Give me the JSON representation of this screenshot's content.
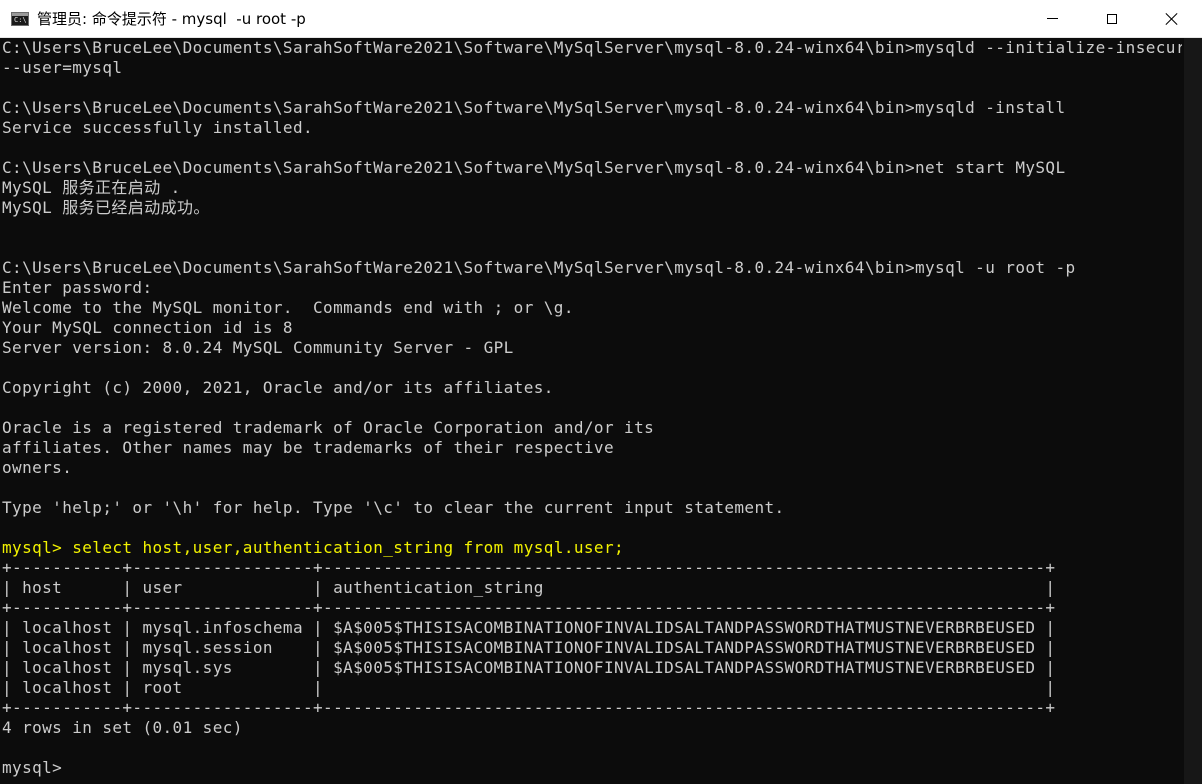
{
  "window": {
    "icon_label": "C:\\",
    "title": "管理员: 命令提示符 - mysql  -u root -p"
  },
  "console": {
    "lines": [
      {
        "text": "C:\\Users\\BruceLee\\Documents\\SarahSoftWare2021\\Software\\MySqlServer\\mysql-8.0.24-winx64\\bin>mysqld --initialize-insecure"
      },
      {
        "text": "--user=mysql"
      },
      {
        "text": ""
      },
      {
        "text": "C:\\Users\\BruceLee\\Documents\\SarahSoftWare2021\\Software\\MySqlServer\\mysql-8.0.24-winx64\\bin>mysqld -install"
      },
      {
        "text": "Service successfully installed."
      },
      {
        "text": ""
      },
      {
        "text": "C:\\Users\\BruceLee\\Documents\\SarahSoftWare2021\\Software\\MySqlServer\\mysql-8.0.24-winx64\\bin>net start MySQL"
      },
      {
        "text": "MySQL 服务正在启动 ."
      },
      {
        "text": "MySQL 服务已经启动成功。"
      },
      {
        "text": ""
      },
      {
        "text": ""
      },
      {
        "text": "C:\\Users\\BruceLee\\Documents\\SarahSoftWare2021\\Software\\MySqlServer\\mysql-8.0.24-winx64\\bin>mysql -u root -p"
      },
      {
        "text": "Enter password:"
      },
      {
        "text": "Welcome to the MySQL monitor.  Commands end with ; or \\g."
      },
      {
        "text": "Your MySQL connection id is 8"
      },
      {
        "text": "Server version: 8.0.24 MySQL Community Server - GPL"
      },
      {
        "text": ""
      },
      {
        "text": "Copyright (c) 2000, 2021, Oracle and/or its affiliates."
      },
      {
        "text": ""
      },
      {
        "text": "Oracle is a registered trademark of Oracle Corporation and/or its"
      },
      {
        "text": "affiliates. Other names may be trademarks of their respective"
      },
      {
        "text": "owners."
      },
      {
        "text": ""
      },
      {
        "text": "Type 'help;' or '\\h' for help. Type '\\c' to clear the current input statement."
      },
      {
        "text": ""
      },
      {
        "text": "mysql> select host,user,authentication_string from mysql.user;",
        "highlight": true
      },
      {
        "text": "+-----------+------------------+------------------------------------------------------------------------+"
      },
      {
        "text": "| host      | user             | authentication_string                                                  |"
      },
      {
        "text": "+-----------+------------------+------------------------------------------------------------------------+"
      },
      {
        "text": "| localhost | mysql.infoschema | $A$005$THISISACOMBINATIONOFINVALIDSALTANDPASSWORDTHATMUSTNEVERBRBEUSED |"
      },
      {
        "text": "| localhost | mysql.session    | $A$005$THISISACOMBINATIONOFINVALIDSALTANDPASSWORDTHATMUSTNEVERBRBEUSED |"
      },
      {
        "text": "| localhost | mysql.sys        | $A$005$THISISACOMBINATIONOFINVALIDSALTANDPASSWORDTHATMUSTNEVERBRBEUSED |"
      },
      {
        "text": "| localhost | root             |                                                                        |"
      },
      {
        "text": "+-----------+------------------+------------------------------------------------------------------------+"
      },
      {
        "text": "4 rows in set (0.01 sec)"
      },
      {
        "text": ""
      },
      {
        "text": "mysql>"
      }
    ]
  },
  "colors": {
    "console_background": "#0c0c0c",
    "console_text": "#cccccc",
    "command_highlight": "#f2f200",
    "titlebar_background": "#ffffff"
  },
  "icons": {
    "app": "cmd-icon",
    "minimize": "minimize-icon",
    "maximize": "maximize-icon",
    "close": "close-icon"
  }
}
